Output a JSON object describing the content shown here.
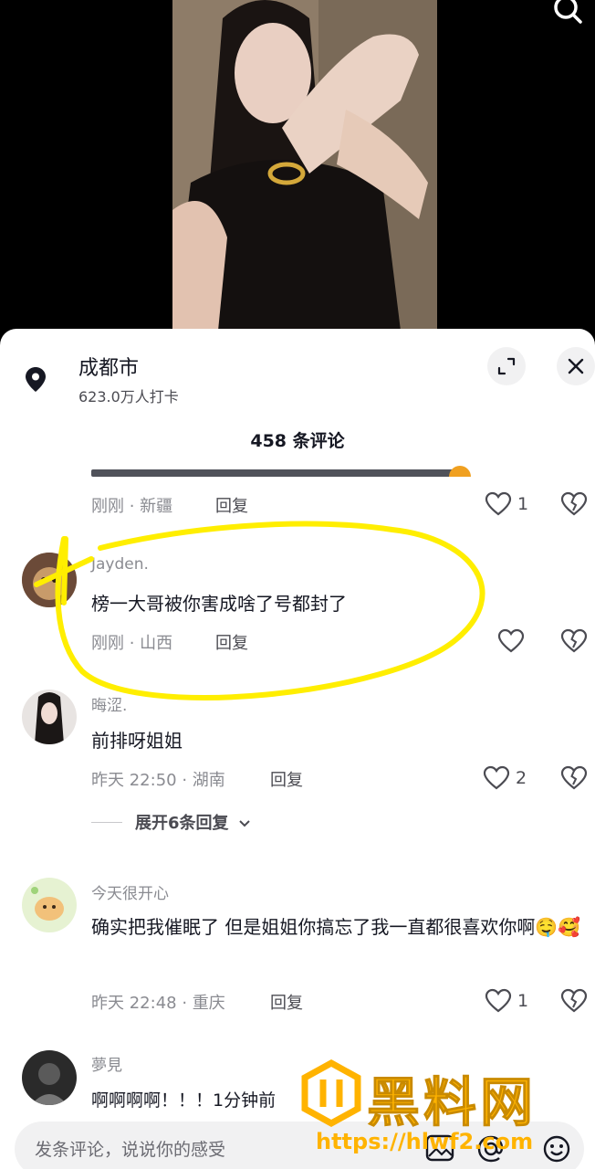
{
  "location": {
    "name": "成都市",
    "checkins": "623.0万人打卡"
  },
  "comments_count": "458 条评论",
  "comments": [
    {
      "partial_text": "",
      "meta": "刚刚 · 新疆",
      "reply": "回复",
      "likes": "1"
    },
    {
      "username": "Jayden.",
      "text": "榜一大哥被你害成啥了号都封了",
      "meta": "刚刚 · 山西",
      "reply": "回复",
      "likes": ""
    },
    {
      "username": "晦涩.",
      "text": "前排呀姐姐",
      "meta": "昨天 22:50 · 湖南",
      "reply": "回复",
      "likes": "2",
      "expand": "展开6条回复"
    },
    {
      "username": "今天很开心",
      "text": "确实把我催眠了 但是姐姐你搞忘了我一直都很喜欢你啊🤤🥰",
      "meta": "昨天 22:48 · 重庆",
      "reply": "回复",
      "likes": "1"
    },
    {
      "username": "夢見",
      "text": "啊啊啊啊！！！1分钟前",
      "meta": "",
      "reply": "",
      "likes": ""
    }
  ],
  "input": {
    "placeholder": "发条评论，说说你的感受"
  },
  "watermark": {
    "brand": "黑料网",
    "url": "https://hlwf2.com"
  },
  "colors": {
    "highlight": "#ffee00",
    "watermark": "#ffb300"
  }
}
